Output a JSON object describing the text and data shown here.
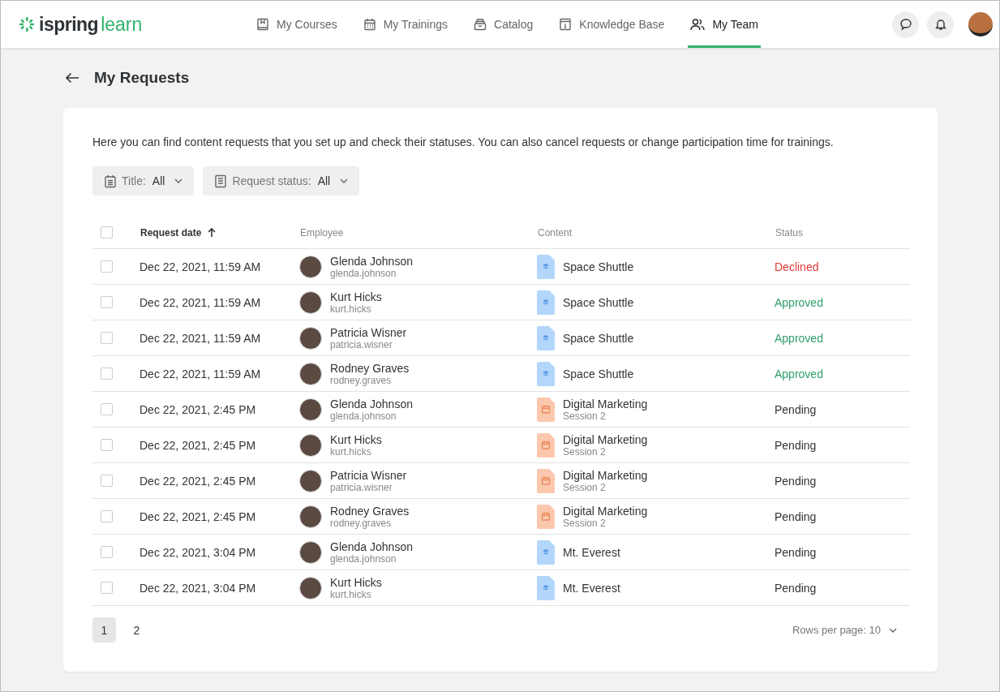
{
  "header": {
    "logo": {
      "part_1": "ispring",
      "part_2": "learn"
    },
    "nav": [
      {
        "label": "My Courses",
        "selected": false
      },
      {
        "label": "My Trainings",
        "selected": false
      },
      {
        "label": "Catalog",
        "selected": false
      },
      {
        "label": "Knowledge Base",
        "selected": false
      },
      {
        "label": "My Team",
        "selected": true
      }
    ]
  },
  "page": {
    "title": "My Requests",
    "description": "Here you can find content requests that you set up and check their statuses. You can also cancel requests or change participation time for trainings."
  },
  "filters": [
    {
      "label": "Title:",
      "value": "All"
    },
    {
      "label": "Request status:",
      "value": "All"
    }
  ],
  "table": {
    "columns": [
      "Request date",
      "Employee",
      "Content",
      "Status"
    ],
    "all_checked": false,
    "rows": [
      {
        "checked": false,
        "date": "Dec 22, 2021, 11:59 AM",
        "name": "Glenda Johnson",
        "login": "glenda.johnson",
        "kind": "course",
        "content": "Space Shuttle",
        "status": {
          "text": "Declined",
          "color": "#e53935"
        }
      },
      {
        "checked": false,
        "date": "Dec 22, 2021, 11:59 AM",
        "name": "Kurt Hicks",
        "login": "kurt.hicks",
        "kind": "course",
        "content": "Space Shuttle",
        "status": {
          "text": "Approved",
          "color": "#2e9e6b"
        }
      },
      {
        "checked": false,
        "date": "Dec 22, 2021, 11:59 AM",
        "name": "Patricia Wisner",
        "login": "patricia.wisner",
        "kind": "course",
        "content": "Space Shuttle",
        "status": {
          "text": "Approved",
          "color": "#2e9e6b"
        }
      },
      {
        "checked": false,
        "date": "Dec 22, 2021, 11:59 AM",
        "name": "Rodney Graves",
        "login": "rodney.graves",
        "kind": "course",
        "content": "Space Shuttle",
        "status": {
          "text": "Approved",
          "color": "#2e9e6b"
        }
      },
      {
        "checked": false,
        "date": "Dec 22, 2021, 2:45 PM",
        "name": "Glenda Johnson",
        "login": "glenda.johnson",
        "kind": "training",
        "content": "Digital Marketing",
        "session": "Session 2",
        "status": {
          "text": "Pending",
          "color": "#333333"
        }
      },
      {
        "checked": false,
        "date": "Dec 22, 2021, 2:45 PM",
        "name": "Kurt Hicks",
        "login": "kurt.hicks",
        "kind": "training",
        "content": "Digital Marketing",
        "session": "Session 2",
        "status": {
          "text": "Pending",
          "color": "#333333"
        }
      },
      {
        "checked": false,
        "date": "Dec 22, 2021, 2:45 PM",
        "name": "Patricia Wisner",
        "login": "patricia.wisner",
        "kind": "training",
        "content": "Digital Marketing",
        "session": "Session 2",
        "status": {
          "text": "Pending",
          "color": "#333333"
        }
      },
      {
        "checked": false,
        "date": "Dec 22, 2021, 2:45 PM",
        "name": "Rodney Graves",
        "login": "rodney.graves",
        "kind": "training",
        "content": "Digital Marketing",
        "session": "Session 2",
        "status": {
          "text": "Pending",
          "color": "#333333"
        }
      },
      {
        "checked": false,
        "date": "Dec 22, 2021, 3:04 PM",
        "name": "Glenda Johnson",
        "login": "glenda.johnson",
        "kind": "course",
        "content": "Mt. Everest",
        "status": {
          "text": "Pending",
          "color": "#333333"
        }
      },
      {
        "checked": false,
        "date": "Dec 22, 2021, 3:04 PM",
        "name": "Kurt Hicks",
        "login": "kurt.hicks",
        "kind": "course",
        "content": "Mt. Everest",
        "status": {
          "text": "Pending",
          "color": "#333333"
        }
      }
    ]
  },
  "pagination": {
    "pages": [
      {
        "label": "1",
        "selected": true
      },
      {
        "label": "2",
        "selected": false
      }
    ],
    "rows_per_page": "Rows per page: 10"
  }
}
